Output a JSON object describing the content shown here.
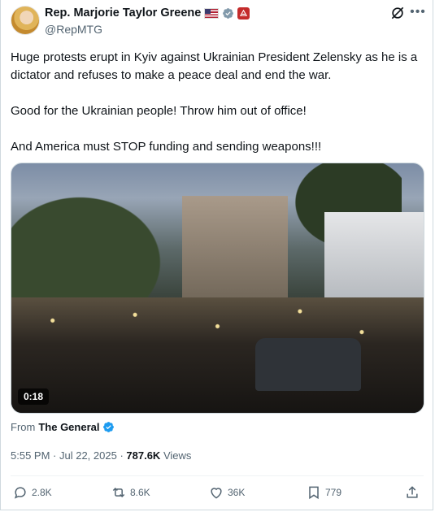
{
  "author": {
    "display_name": "Rep. Marjorie Taylor Greene",
    "handle": "@RepMTG"
  },
  "tweet": {
    "paragraphs": [
      "Huge protests erupt in Kyiv against Ukrainian President Zelensky as he is a dictator and refuses to make a peace deal and end the war.",
      "Good for the Ukrainian people! Throw him out of office!",
      "And America must STOP funding and sending weapons!!!"
    ]
  },
  "media": {
    "duration": "0:18"
  },
  "source": {
    "prefix": "From",
    "name": "The General"
  },
  "meta": {
    "time": "5:55 PM",
    "separator1": " · ",
    "date": "Jul 22, 2025",
    "separator2": " · ",
    "views_count": "787.6K",
    "views_label": "Views"
  },
  "actions": {
    "replies": "2.8K",
    "reposts": "8.6K",
    "likes": "36K",
    "bookmarks": "779"
  },
  "colors": {
    "verified_blue": "#1d9bf0",
    "verified_gray": "#829aab",
    "affiliation_red": "#c42b2b"
  },
  "icons": [
    "us-flag-icon",
    "gray-verified-icon",
    "affiliation-badge-icon",
    "grok-icon",
    "more-icon",
    "blue-verified-icon",
    "reply-icon",
    "repost-icon",
    "like-icon",
    "bookmark-icon",
    "share-icon"
  ]
}
